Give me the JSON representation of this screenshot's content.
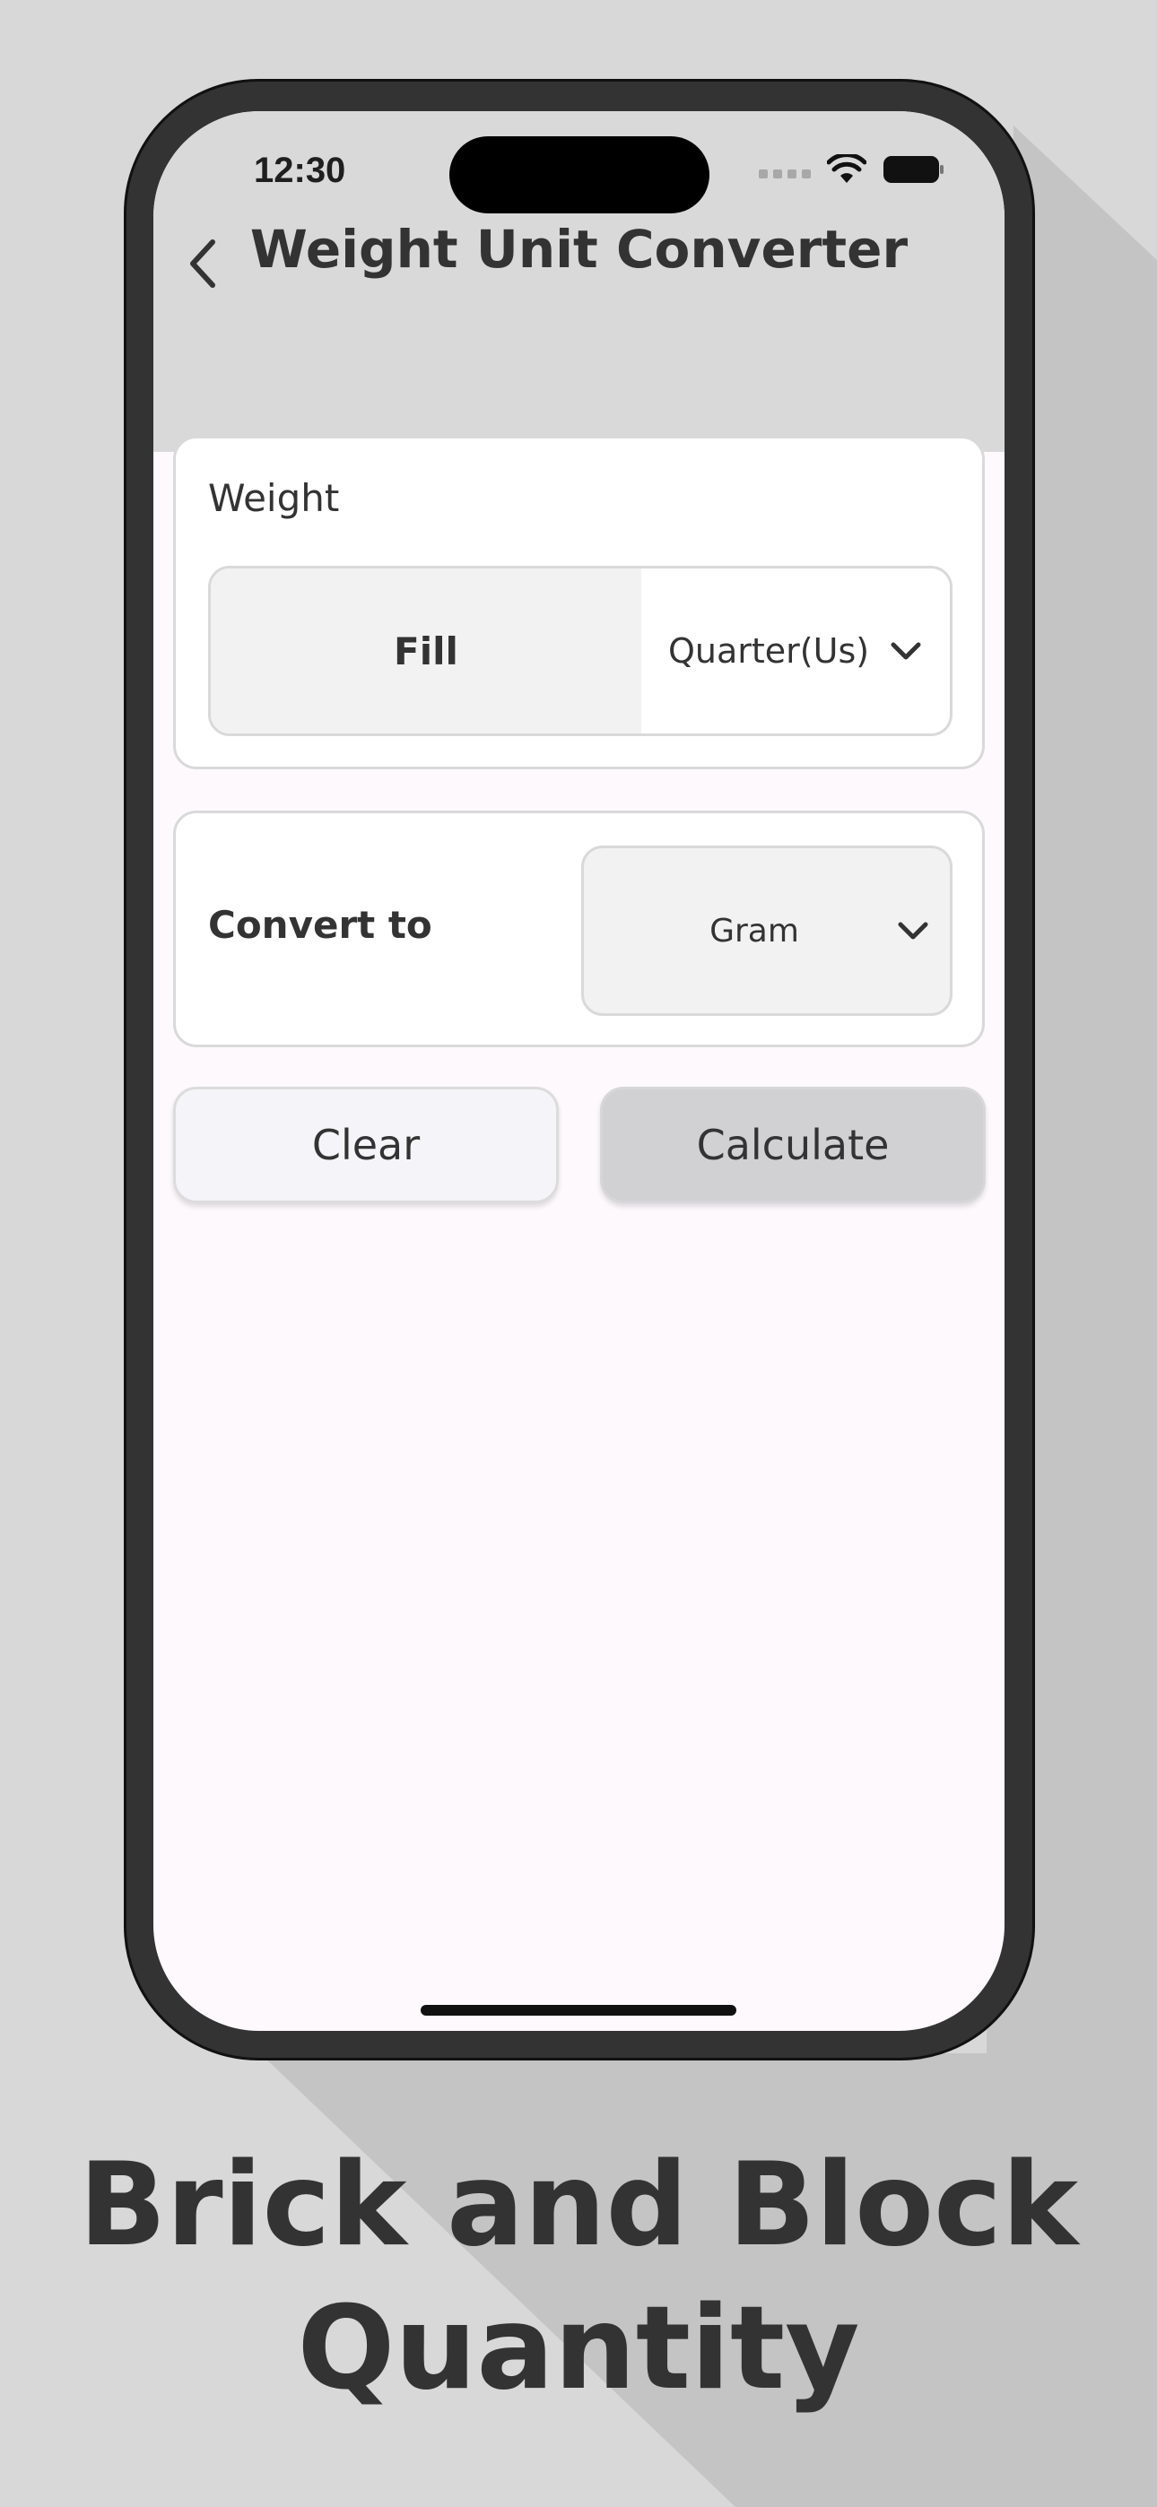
{
  "status_bar": {
    "time": "12:30"
  },
  "header": {
    "title": "Weight Unit Converter"
  },
  "weight_card": {
    "label": "Weight",
    "input_value": "Fill",
    "unit_selected": "Quarter(Us)"
  },
  "convert_card": {
    "label": "Convert to",
    "unit_selected": "Gram"
  },
  "buttons": {
    "clear_label": "Clear",
    "calculate_label": "Calculate"
  },
  "promo": {
    "line1": "Brick and Block",
    "line2": "Quantity"
  },
  "icons": {
    "back": "chevron-left-icon",
    "dropdown": "chevron-down-icon",
    "wifi": "wifi-icon",
    "battery": "battery-icon"
  },
  "colors": {
    "background": "#d8d8d8",
    "phone_frame": "#333333",
    "screen_bg": "#fef9fd",
    "header_bg": "#d9d9d9",
    "calculate_btn": "#d1d1d4",
    "clear_btn": "#f5f5f9",
    "text": "#333333"
  }
}
